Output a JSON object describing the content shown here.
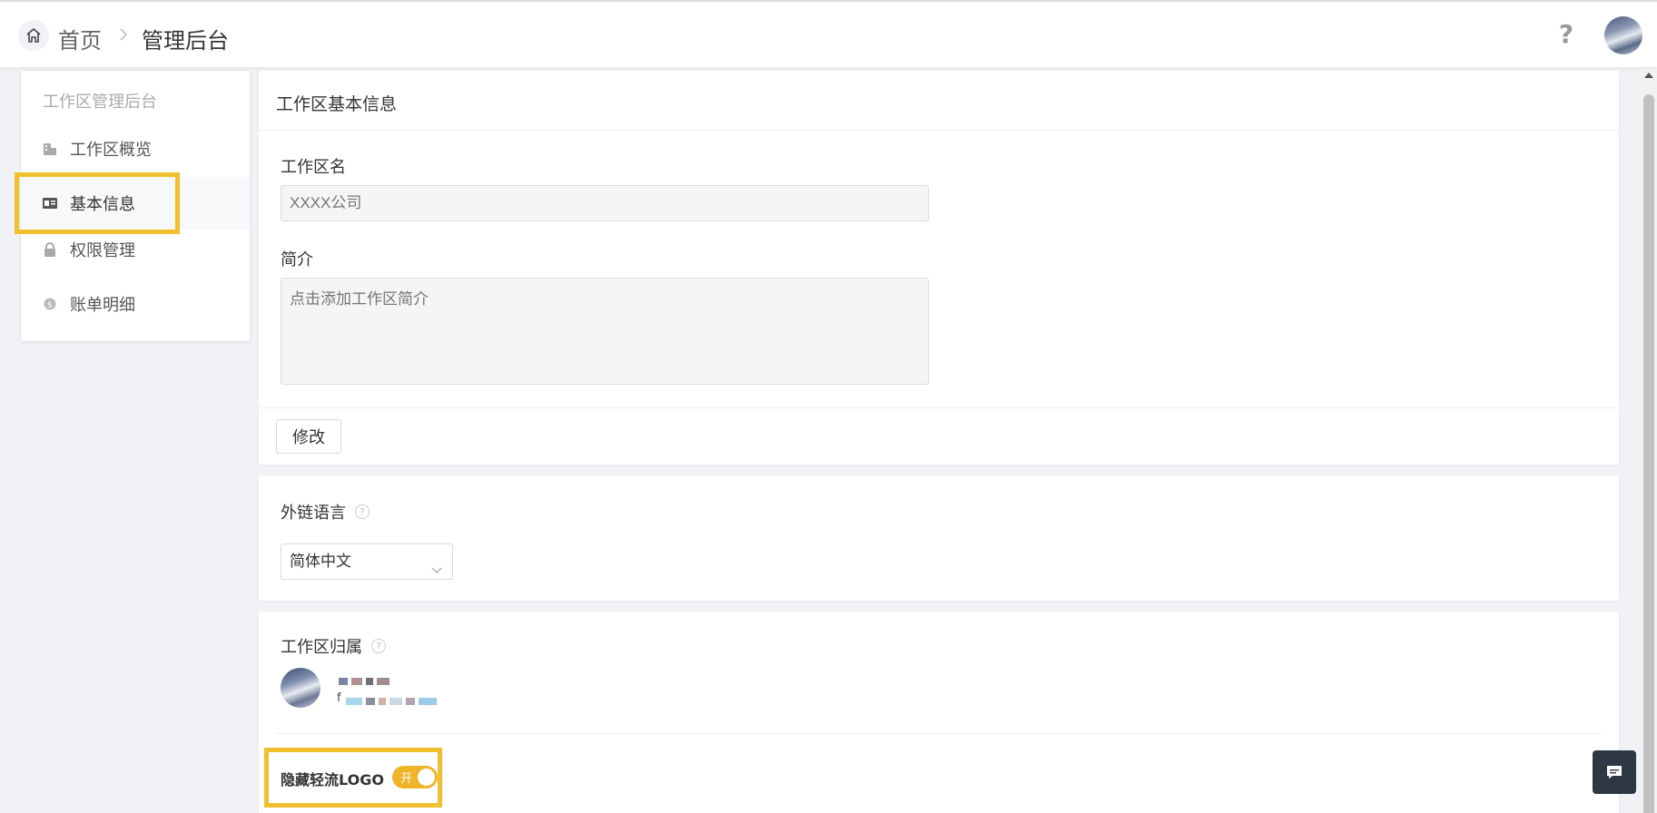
{
  "header": {
    "breadcrumb_home": "首页",
    "breadcrumb_current": "管理后台",
    "help_label": "?"
  },
  "sidebar": {
    "title": "工作区管理后台",
    "items": [
      {
        "label": "工作区概览",
        "icon": "building-icon"
      },
      {
        "label": "基本信息",
        "icon": "id-card-icon",
        "active": true
      },
      {
        "label": "权限管理",
        "icon": "lock-icon"
      },
      {
        "label": "账单明细",
        "icon": "coin-icon"
      }
    ]
  },
  "basic_info": {
    "title": "工作区基本信息",
    "name_label": "工作区名",
    "name_placeholder": "XXXX公司",
    "intro_label": "简介",
    "intro_placeholder": "点击添加工作区简介",
    "modify_button": "修改"
  },
  "link_language": {
    "label": "外链语言",
    "help_icon": "?",
    "selected": "简体中文"
  },
  "ownership": {
    "label": "工作区归属",
    "help_icon": "?",
    "email_prefix": "f",
    "hide_logo_label": "隐藏轻流LOGO",
    "hide_logo_toggle_text": "开",
    "hide_logo_enabled": true
  },
  "colors": {
    "highlight": "#f0c02e",
    "toggle_on": "#f0b429",
    "chat_button": "#2e3845"
  }
}
